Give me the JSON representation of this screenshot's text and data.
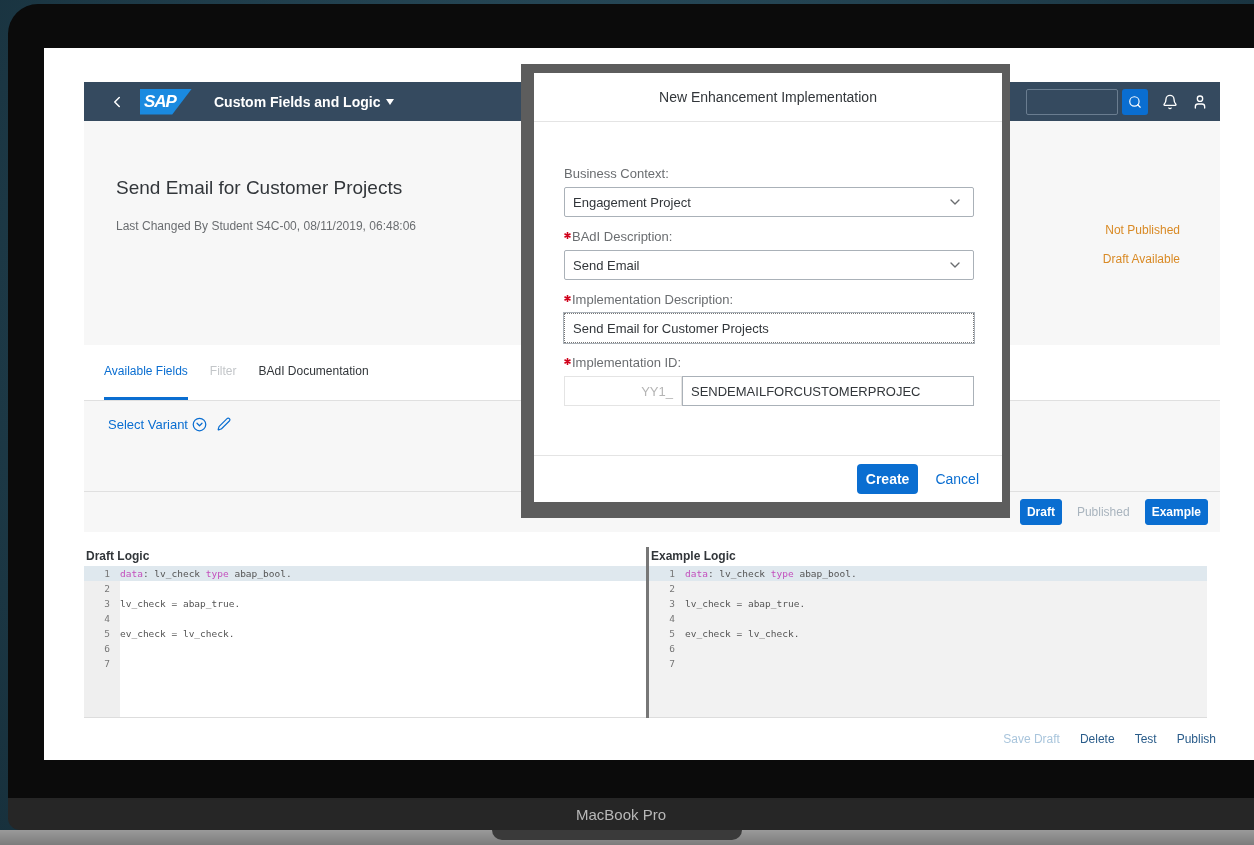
{
  "shell": {
    "logo": "SAP",
    "title": "Custom Fields and Logic"
  },
  "header": {
    "title": "Send Email for Customer Projects",
    "subtitle": "Last Changed By Student S4C-00, 08/11/2019, 06:48:06",
    "statuses": [
      "Not Published",
      "Draft Available"
    ]
  },
  "tabs": [
    {
      "label": "Available Fields",
      "selected": true,
      "disabled": false
    },
    {
      "label": "Filter",
      "selected": false,
      "disabled": true
    },
    {
      "label": "BAdI Documentation",
      "selected": false,
      "disabled": false
    }
  ],
  "variant": {
    "label": "Select Variant"
  },
  "view_buttons": [
    {
      "label": "Draft",
      "selected": true,
      "disabled": false
    },
    {
      "label": "Published",
      "selected": false,
      "disabled": true
    },
    {
      "label": "Example",
      "selected": true,
      "disabled": false
    }
  ],
  "editors": [
    {
      "title": "Draft Logic",
      "read_only": false,
      "lines": [
        {
          "number": "1",
          "highlighted": true,
          "tokens": [
            {
              "text": "data",
              "kind": "keyword"
            },
            {
              "text": ": lv_check ",
              "kind": "plain"
            },
            {
              "text": "type",
              "kind": "keyword"
            },
            {
              "text": " abap_bool.",
              "kind": "plain"
            }
          ]
        },
        {
          "number": "2",
          "highlighted": false
        },
        {
          "number": "3",
          "highlighted": false,
          "tokens": [
            {
              "text": "lv_check = abap_true.",
              "kind": "plain"
            }
          ]
        },
        {
          "number": "4",
          "highlighted": false
        },
        {
          "number": "5",
          "highlighted": false,
          "tokens": [
            {
              "text": "ev_check = lv_check.",
              "kind": "plain"
            }
          ]
        },
        {
          "number": "6",
          "highlighted": false
        },
        {
          "number": "7",
          "highlighted": false
        }
      ]
    },
    {
      "title": "Example Logic",
      "read_only": true,
      "lines": [
        {
          "number": "1",
          "highlighted": true,
          "tokens": [
            {
              "text": "data",
              "kind": "keyword"
            },
            {
              "text": ": lv_check ",
              "kind": "plain"
            },
            {
              "text": "type",
              "kind": "keyword"
            },
            {
              "text": " abap_bool.",
              "kind": "plain"
            }
          ]
        },
        {
          "number": "2",
          "highlighted": false
        },
        {
          "number": "3",
          "highlighted": false,
          "tokens": [
            {
              "text": "lv_check = abap_true.",
              "kind": "plain"
            }
          ]
        },
        {
          "number": "4",
          "highlighted": false
        },
        {
          "number": "5",
          "highlighted": false,
          "tokens": [
            {
              "text": "ev_check = lv_check.",
              "kind": "plain"
            }
          ]
        },
        {
          "number": "6",
          "highlighted": false
        },
        {
          "number": "7",
          "highlighted": false
        }
      ]
    }
  ],
  "actions": [
    {
      "label": "Save Draft",
      "disabled": true
    },
    {
      "label": "Delete",
      "disabled": false
    },
    {
      "label": "Test",
      "disabled": false
    },
    {
      "label": "Publish",
      "disabled": false
    }
  ],
  "dialog": {
    "title": "New Enhancement Implementation",
    "fields": [
      {
        "label": "Business Context:",
        "required": false,
        "kind": "select",
        "value": "Engagement Project"
      },
      {
        "label": "BAdI Description:",
        "required": true,
        "kind": "select",
        "value": "Send Email"
      },
      {
        "label": "Implementation Description:",
        "required": true,
        "kind": "input",
        "value": "Send Email for Customer Projects"
      },
      {
        "label": "Implementation ID:",
        "required": true,
        "kind": "prefixed",
        "prefix": "YY1_",
        "value": "SENDEMAILFORCUSTOMERPROJEC"
      }
    ],
    "buttons": [
      {
        "label": "Create",
        "kind": "emphasized"
      },
      {
        "label": "Cancel",
        "kind": "transparent"
      }
    ]
  },
  "laptop": {
    "label": "MacBook Pro"
  }
}
